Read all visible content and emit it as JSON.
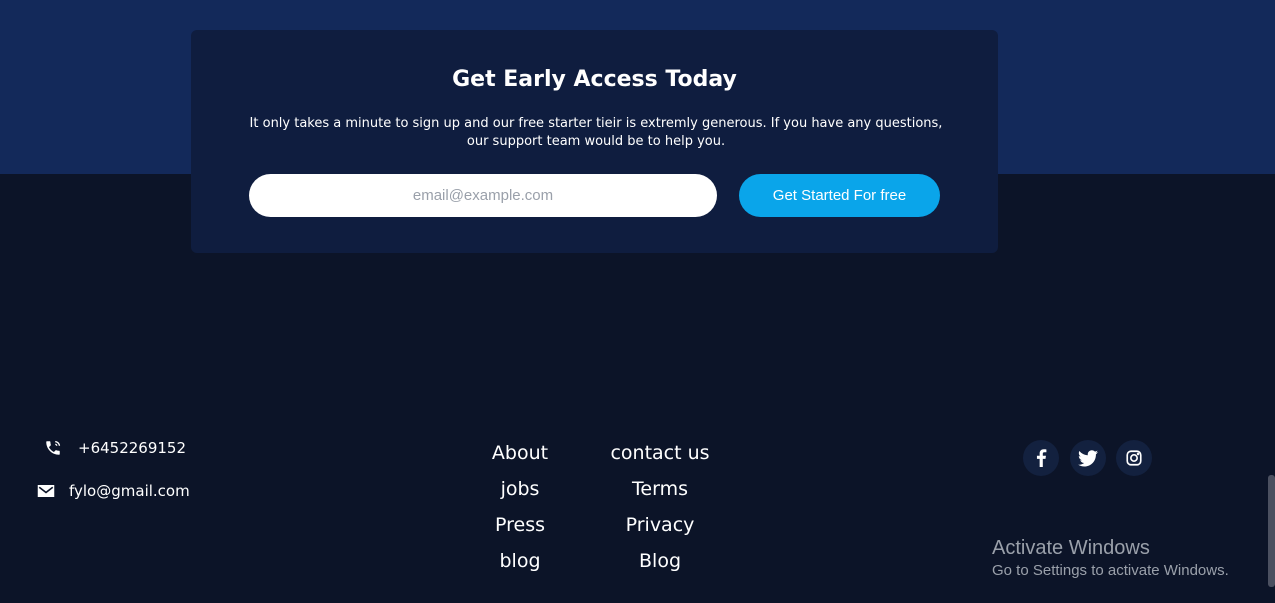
{
  "cta": {
    "title": "Get Early Access Today",
    "text": "It only takes a minute to sign up and our free starter tieir is extremly generous. If you have any questions, our support team would be to help you.",
    "email_placeholder": "email@example.com",
    "button_label": "Get Started For free"
  },
  "contact": {
    "phone": "+6452269152",
    "email": "fylo@gmail.com",
    "phone_icon": "phone-icon",
    "email_icon": "mail-icon"
  },
  "footer_links": {
    "col1": [
      "About",
      "jobs",
      "Press",
      "blog"
    ],
    "col2": [
      "contact us",
      "Terms",
      "Privacy",
      "Blog"
    ]
  },
  "social": [
    {
      "name": "facebook-icon"
    },
    {
      "name": "twitter-icon"
    },
    {
      "name": "instagram-icon"
    }
  ],
  "windows_watermark": {
    "line1": "Activate Windows",
    "line2": "Go to Settings to activate Windows."
  },
  "colors": {
    "page_bg": "#0c1428",
    "top_band": "#13295a",
    "card_bg": "#0f1d3f",
    "accent": "#0aa5ea"
  }
}
